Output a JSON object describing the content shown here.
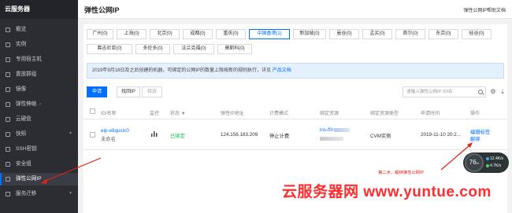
{
  "sidebar": {
    "title": "云服务器",
    "items": [
      {
        "label": "概览",
        "icon": "grid-icon"
      },
      {
        "label": "实例",
        "icon": "instance-icon"
      },
      {
        "label": "专用宿主机",
        "icon": "host-icon"
      },
      {
        "label": "置放群组",
        "icon": "group-icon"
      },
      {
        "label": "镜像",
        "icon": "image-icon"
      },
      {
        "label": "弹性伸缩",
        "icon": "scaling-icon"
      },
      {
        "label": "云硬盘",
        "icon": "disk-icon"
      },
      {
        "label": "快照",
        "icon": "snapshot-icon"
      },
      {
        "label": "SSH密钥",
        "icon": "key-icon"
      },
      {
        "label": "安全组",
        "icon": "shield-icon"
      },
      {
        "label": "弹性公网IP",
        "icon": "eip-icon"
      },
      {
        "label": "服务迁移",
        "icon": "migrate-icon"
      }
    ]
  },
  "header": {
    "title": "弹性公网IP",
    "help_link": "弹性公网IP帮助文档"
  },
  "regions": [
    "广州(0)",
    "上海(0)",
    "北京(0)",
    "成都(0)",
    "重庆(0)",
    "中国香港(1)",
    "新加坡(0)",
    "曼谷(0)",
    "孟买(0)",
    "首尔(0)",
    "东京(0)",
    "硅谷(0)",
    "弗吉尼亚(0)",
    "多伦多(0)",
    "法兰克福(0)",
    "莫斯科(0)"
  ],
  "notice": {
    "text": "2019年9月18日及之后创建的机器，可绑定的公网IP的数量上限按新的规则执行，详见",
    "link": "产品文档"
  },
  "toolbar": {
    "apply": "申请",
    "retrieve": "找回IP",
    "release": "释放",
    "search_placeholder": "请输入弹性公网IP ID/名",
    "settings_icon": "gear-icon",
    "download_icon": "download-icon"
  },
  "table": {
    "headers": {
      "id_name": "ID/名称",
      "monitor": "监控",
      "status": "状态",
      "eip": "弹性IP地址",
      "billing": "计费模式",
      "bound_resource": "绑定资源",
      "bound_type": "绑定资源类型",
      "apply_time": "申请时间",
      "actions": "操作"
    },
    "row": {
      "id": "eip-e8qucic0",
      "name": "未命名",
      "status": "已绑定",
      "eip": "124.156.183.209",
      "billing": "停止计费",
      "resource_prefix": "ins-f0r",
      "resource_type": "CVM实例",
      "apply_time": "2019-11-10 20:2...",
      "action_edit": "编辑标签",
      "action_unbind": "解绑"
    }
  },
  "monitor": {
    "cpu": "76",
    "cpu_unit": "%",
    "up": "12.4",
    "up_unit": "K/s",
    "down": "4.7",
    "down_unit": "K/s"
  },
  "annotation": "第二步，解绑弹性公网IP",
  "watermark": "云服务器网 www.yuntue.com",
  "colors": {
    "accent": "#006eff",
    "sidebar_bg": "#2b2d33",
    "bound": "#0abf5b",
    "annotation": "#e2231a"
  }
}
